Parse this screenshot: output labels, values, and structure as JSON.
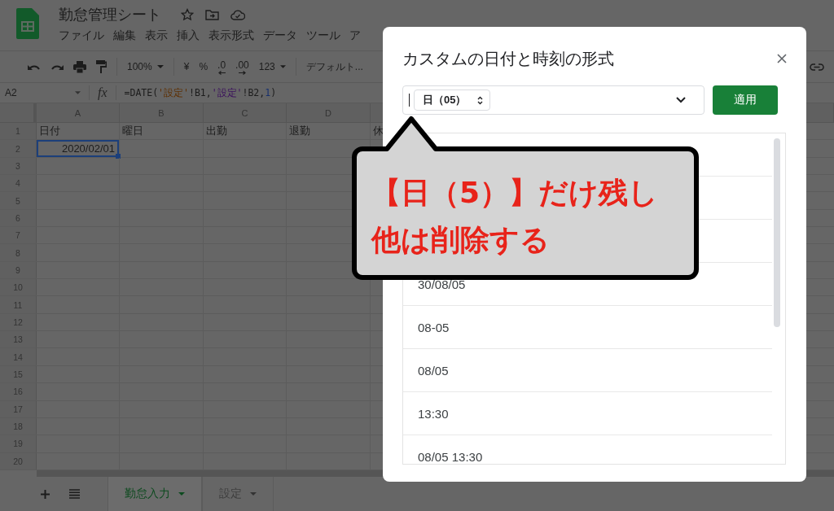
{
  "app": {
    "title": "勤怠管理シート",
    "menu": [
      "ファイル",
      "編集",
      "表示",
      "挿入",
      "表示形式",
      "データ",
      "ツール",
      "ア"
    ]
  },
  "toolbar": {
    "zoom": "100%",
    "currency": "¥",
    "percent": "%",
    "decrease_decimals": ".0",
    "increase_decimals": ".00",
    "more_formats": "123",
    "font": "デフォルト..."
  },
  "formula_bar": {
    "name_box": "A2",
    "function_symbol": "fx",
    "formula": [
      {
        "kind": "text",
        "text": "=DATE("
      },
      {
        "kind": "ref_a",
        "text": "'設定'"
      },
      {
        "kind": "text",
        "text": "!B1,"
      },
      {
        "kind": "ref_b",
        "text": "'設定'"
      },
      {
        "kind": "text",
        "text": "!B2,"
      },
      {
        "kind": "number",
        "text": "1"
      },
      {
        "kind": "text",
        "text": ")"
      }
    ]
  },
  "columns": [
    "A",
    "B",
    "C",
    "D"
  ],
  "rows": [
    {
      "label": "1",
      "cells": [
        {
          "text": "日付",
          "selected": false
        },
        {
          "text": "曜日",
          "selected": false
        },
        {
          "text": "出勤",
          "selected": false
        },
        {
          "text": "退勤",
          "selected": false
        },
        {
          "text": "休",
          "selected": false
        }
      ]
    },
    {
      "label": "2",
      "cells": [
        {
          "text": "2020/02/01",
          "selected": true
        }
      ]
    },
    {
      "label": "3"
    },
    {
      "label": "4"
    },
    {
      "label": "5"
    },
    {
      "label": "6"
    },
    {
      "label": "7"
    },
    {
      "label": "8"
    },
    {
      "label": "9"
    },
    {
      "label": "10"
    },
    {
      "label": "11"
    },
    {
      "label": "12"
    },
    {
      "label": "13"
    },
    {
      "label": "14"
    },
    {
      "label": "15"
    },
    {
      "label": "16"
    },
    {
      "label": "17"
    },
    {
      "label": "18"
    },
    {
      "label": "19"
    },
    {
      "label": "20"
    }
  ],
  "sheet_tabs": [
    {
      "label": "勤怠入力",
      "selected": true
    },
    {
      "label": "設定",
      "selected": false
    }
  ],
  "dialog": {
    "title": "カスタムの日付と時刻の形式",
    "format_chip": "日（05）",
    "apply_button": "適用",
    "options": [
      "30/08/05",
      "08-05",
      "08/05",
      "13:30",
      "08/05 13:30"
    ]
  },
  "callout": {
    "lines": [
      "【日（5）】だけ残し",
      "他は削除する"
    ]
  }
}
